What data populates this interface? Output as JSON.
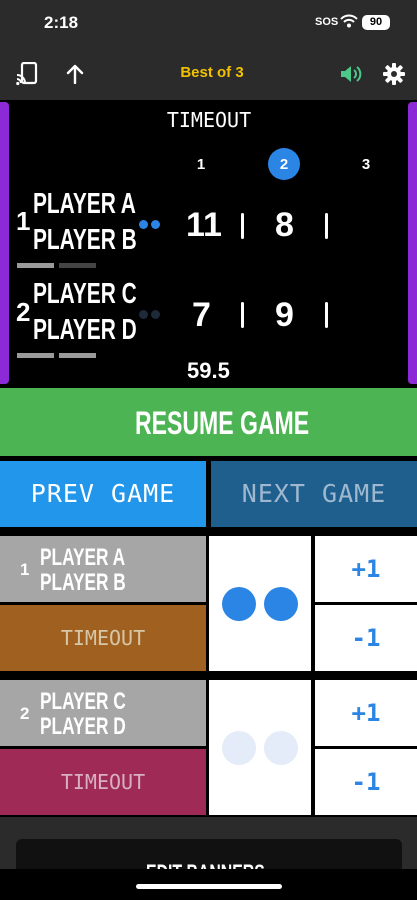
{
  "status_bar": {
    "time": "2:18",
    "sos": "SOS",
    "battery": "90"
  },
  "toolbar": {
    "title": "Best of 3"
  },
  "scoreboard": {
    "status": "TIMEOUT",
    "games": [
      "1",
      "2",
      "3"
    ],
    "current_game": "2",
    "timer": "59.5",
    "teams": [
      {
        "number": "1",
        "players": [
          "PLAYER A",
          "PLAYER B"
        ],
        "scores": [
          "11",
          "8",
          ""
        ]
      },
      {
        "number": "2",
        "players": [
          "PLAYER C",
          "PLAYER D"
        ],
        "scores": [
          "7",
          "9",
          ""
        ]
      }
    ]
  },
  "actions": {
    "resume": "RESUME GAME",
    "prev": "PREV GAME",
    "next": "NEXT GAME"
  },
  "teams_panel": [
    {
      "number": "1",
      "players": [
        "PLAYER A",
        "PLAYER B"
      ],
      "timeout_label": "TIMEOUT",
      "plus": "+1",
      "minus": "-1"
    },
    {
      "number": "2",
      "players": [
        "PLAYER C",
        "PLAYER D"
      ],
      "timeout_label": "TIMEOUT",
      "plus": "+1",
      "minus": "-1"
    }
  ],
  "bottom": {
    "edit_banners": "EDIT BANNERS"
  },
  "colors": {
    "accent_yellow": "#f2c200",
    "resume_green": "#4cb453",
    "prev_blue": "#2196ea",
    "next_blue": "#1f5f8e",
    "team1_timeout": "#a0601f",
    "team2_timeout": "#9e2a55",
    "serve_active": "#2b85e4",
    "serve_inactive": "#e3ecf8"
  },
  "icons": [
    "cast-icon",
    "up-arrow-icon",
    "speaker-icon",
    "gear-icon"
  ]
}
